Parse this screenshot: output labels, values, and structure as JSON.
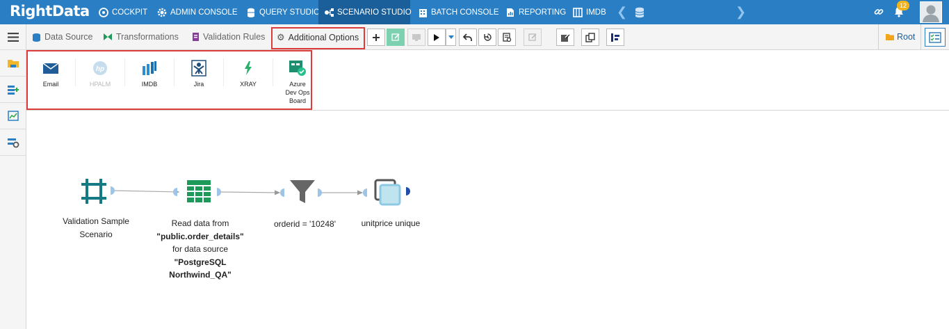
{
  "app": {
    "logo": "RightData"
  },
  "topnav": {
    "items": [
      {
        "label": "COCKPIT",
        "icon": "cockpit-icon"
      },
      {
        "label": "ADMIN CONSOLE",
        "icon": "gear-icon"
      },
      {
        "label": "QUERY STUDIO",
        "icon": "database-icon"
      },
      {
        "label": "SCENARIO STUDIO",
        "icon": "scenario-icon",
        "active": true
      },
      {
        "label": "BATCH CONSOLE",
        "icon": "building-icon"
      },
      {
        "label": "REPORTING",
        "icon": "report-icon"
      },
      {
        "label": "IMDB",
        "icon": "imdb-icon"
      }
    ],
    "notifications": "12"
  },
  "toolbar": {
    "tabs": {
      "data_source": "Data Source",
      "transformations": "Transformations",
      "validation_rules": "Validation Rules",
      "additional_options": "Additional Options"
    },
    "root_label": "Root"
  },
  "options": {
    "email": "Email",
    "hpalm": "HPALM",
    "imdb": "IMDB",
    "jira": "Jira",
    "xray": "XRAY",
    "azure_line1": "Azure",
    "azure_line2": "Dev Ops",
    "azure_line3": "Board"
  },
  "flow": {
    "node1_line1": "Validation Sample",
    "node1_line2": "Scenario",
    "node2_line1": "Read data from",
    "node2_line2": "\"public.order_details\"",
    "node2_line3": "for data source",
    "node2_line4": "\"PostgreSQL",
    "node2_line5": "Northwind_QA\"",
    "node3": "orderid = '10248'",
    "node4": "unitprice unique"
  },
  "colors": {
    "nav_bg": "#2a7fc4",
    "nav_active": "#1b5f9a",
    "highlight": "#dc3c3c",
    "node_teal": "#167a85",
    "node_green": "#1d9a5a",
    "badge": "#f3b41b"
  }
}
